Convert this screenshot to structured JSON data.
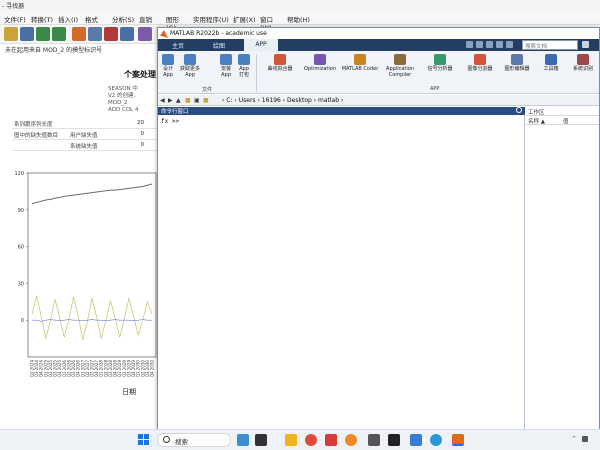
{
  "bg_app": {
    "title": "- 寻找器",
    "menus": [
      "文件(F)",
      "转换(T)",
      "插入(I)",
      "格式(O)",
      "分析(S)",
      "直销(M)",
      "图形(G)",
      "实用程序(U)",
      "扩展(X)",
      "窗口(W)",
      "帮助(H)"
    ],
    "crumb": "未在起用来自 MOD_2 的模型标识号",
    "heading": "个案处理",
    "season_lines": [
      "SEASON 中",
      "V2 的创建、",
      "MOD_2",
      "ADD COL 4"
    ],
    "table": [
      {
        "c1": "系列跟序列长度",
        "c2": "",
        "c3": "20"
      },
      {
        "c1": "图中的缺失值数目",
        "c2": "用户缺失值",
        "c3": "0"
      },
      {
        "c1": "",
        "c2": "系统缺失值",
        "c3": "0"
      }
    ],
    "x_axis_title": "日期"
  },
  "chart_data": {
    "type": "line",
    "yticks": [
      "120",
      "90",
      "60",
      "30",
      "0"
    ],
    "ylim": [
      -30,
      120
    ],
    "x": [
      "Q2 2024",
      "Q3 2024",
      "Q4 2024",
      "Q1 2025",
      "Q2 2025",
      "Q3 2025",
      "Q4 2025",
      "Q1 2026",
      "Q2 2026",
      "Q3 2026",
      "Q4 2026",
      "Q1 2027",
      "Q2 2027",
      "Q3 2027",
      "Q4 2027",
      "Q1 2028",
      "Q2 2028",
      "Q3 2028",
      "Q4 2028",
      "Q1 2029",
      "Q2 2029",
      "Q3 2029",
      "Q4 2029",
      "Q1 2030",
      "Q2 2030",
      "Q3 2030",
      "Q4 2030"
    ],
    "series": [
      {
        "color": "#6a6a6a",
        "values": [
          95,
          96,
          97,
          98,
          98.5,
          99.5,
          100,
          101,
          101.5,
          102,
          102.5,
          103,
          103.5,
          104,
          104.5,
          105,
          105.5,
          106,
          106,
          106.5,
          107,
          107.5,
          108,
          108.5,
          109,
          110,
          111
        ]
      },
      {
        "color": "#c8c06a",
        "values": [
          5,
          20,
          3,
          -15,
          0,
          17,
          2,
          -14,
          1,
          19,
          4,
          -16,
          -1,
          18,
          3,
          -15,
          0,
          16,
          2,
          -14,
          1,
          18,
          3,
          -12,
          0,
          15,
          5
        ]
      },
      {
        "color": "#6f7fd6",
        "values": [
          0,
          0,
          -1,
          0,
          0.5,
          0,
          -0.5,
          0,
          0.5,
          0,
          0,
          -0.5,
          0,
          0.5,
          0,
          0,
          -0.5,
          0,
          0.5,
          0,
          0,
          0,
          -0.5,
          0,
          0.5,
          0,
          0
        ]
      }
    ]
  },
  "matlab": {
    "title": "MATLAB R2022b - academic use",
    "tabs": [
      "主页",
      "绘图",
      "APP"
    ],
    "search_placeholder": "搜索文档",
    "ribbon": [
      {
        "label": "设计 App",
        "color": "#4a7fc1"
      },
      {
        "label": "获取更多 App",
        "color": "#4a7fc1"
      },
      {
        "label": "安装 App",
        "color": "#4a7fc1"
      },
      {
        "label": "App 打包",
        "color": "#4a7fc1"
      },
      {
        "label": "曲线拟合器",
        "color": "#d4553a"
      },
      {
        "label": "Optimization",
        "color": "#7a55b0"
      },
      {
        "label": "MATLAB Coder",
        "color": "#c9861f"
      },
      {
        "label": "Application Compiler",
        "color": "#8a6a3a"
      },
      {
        "label": "信号分析器",
        "color": "#3a9a6a"
      },
      {
        "label": "图像分割器",
        "color": "#d4553a"
      },
      {
        "label": "图形编辑器",
        "color": "#5a7aa9"
      },
      {
        "label": "工具箱",
        "color": "#3a6ab0"
      },
      {
        "label": "系统识别",
        "color": "#9a4a4a"
      }
    ],
    "group_labels": [
      "文件",
      "APP"
    ],
    "path": "› C: › Users › 16196 › Desktop › matlab ›",
    "cmd_label": "命令行窗口",
    "prompt": "fx >>",
    "workspace_label": "工作区",
    "ws_col_name": "名称 ▲",
    "ws_col_value": "值"
  },
  "taskbar": {
    "search_placeholder": "搜索",
    "apps": [
      {
        "name": "widgets-icon",
        "color": "#3a8fd4"
      },
      {
        "name": "file-explorer-icon",
        "color": "#f2b21e"
      },
      {
        "name": "chrome-icon",
        "color": "#e04a3a"
      },
      {
        "name": "wps-icon",
        "color": "#d93b3b"
      },
      {
        "name": "edge-icon",
        "color": "#f08a24"
      },
      {
        "name": "capcut-icon",
        "color": "#222222"
      },
      {
        "name": "mail-icon",
        "color": "#3a7ad4"
      },
      {
        "name": "browser-icon",
        "color": "#2a9ad4"
      },
      {
        "name": "matlab-icon",
        "color": "#e06a1c"
      }
    ]
  }
}
